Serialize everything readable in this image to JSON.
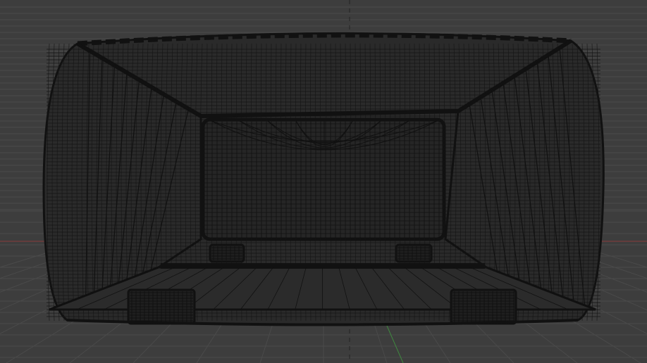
{
  "viewport": {
    "mode": "wireframe",
    "view": "front-orthographic",
    "object": "wireframe-box-mesh",
    "colors": {
      "background": "#3d3d3d",
      "grid": "#4a4a4a",
      "wire": "#111111",
      "x_axis": "#8a3b3b",
      "y_axis": "#3f8a3f",
      "center_line": "#222222"
    }
  }
}
